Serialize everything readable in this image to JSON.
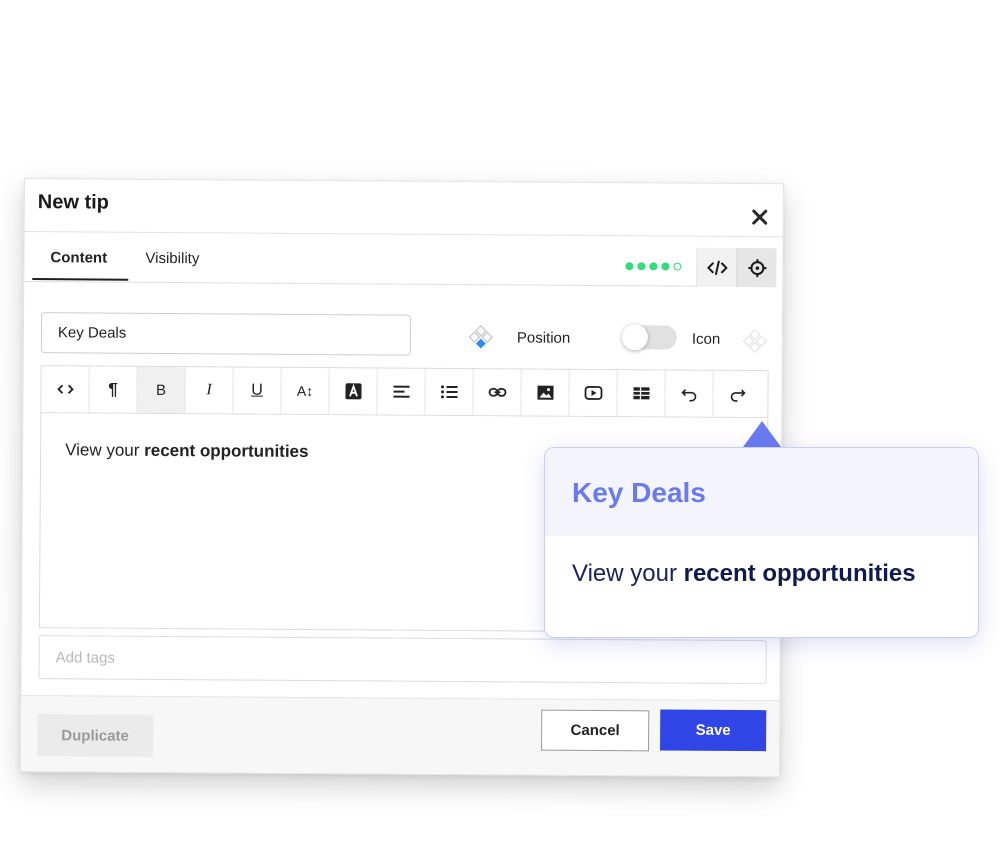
{
  "dialog": {
    "title": "New tip",
    "tabs": [
      {
        "label": "Content",
        "active": true
      },
      {
        "label": "Visibility",
        "active": false
      }
    ],
    "progress_dots": {
      "filled": 4,
      "total": 5,
      "color": "#2fdd7a"
    },
    "header_buttons": [
      "code-icon",
      "target-icon"
    ]
  },
  "form": {
    "title_value": "Key Deals",
    "position_label": "Position",
    "icon_label": "Icon",
    "icon_toggle_on": false,
    "tags_placeholder": "Add tags"
  },
  "toolbar": {
    "buttons": [
      {
        "name": "source-code",
        "glyph": "<>"
      },
      {
        "name": "paragraph",
        "glyph": "¶"
      },
      {
        "name": "bold",
        "glyph": "B"
      },
      {
        "name": "italic",
        "glyph": "I"
      },
      {
        "name": "underline",
        "glyph": "U"
      },
      {
        "name": "font-size",
        "glyph": "A↕"
      },
      {
        "name": "text-color",
        "glyph": "A"
      },
      {
        "name": "align-left",
        "glyph": ""
      },
      {
        "name": "bulleted-list",
        "glyph": ""
      },
      {
        "name": "link",
        "glyph": ""
      },
      {
        "name": "image",
        "glyph": ""
      },
      {
        "name": "video",
        "glyph": ""
      },
      {
        "name": "table",
        "glyph": ""
      },
      {
        "name": "undo",
        "glyph": "↶"
      },
      {
        "name": "redo",
        "glyph": "↷"
      }
    ]
  },
  "editor": {
    "plain_text": "View your ",
    "bold_text": "recent opportunities"
  },
  "footer": {
    "duplicate_label": "Duplicate",
    "cancel_label": "Cancel",
    "save_label": "Save"
  },
  "preview": {
    "title": "Key Deals",
    "body_plain": "View your ",
    "body_bold": "recent opportunities"
  },
  "colors": {
    "primary": "#2f45e6",
    "preview_title": "#6a7af0",
    "preview_body": "#1a2260",
    "status_green": "#2fdd7a",
    "position_diamond": "#2b8cf5"
  }
}
